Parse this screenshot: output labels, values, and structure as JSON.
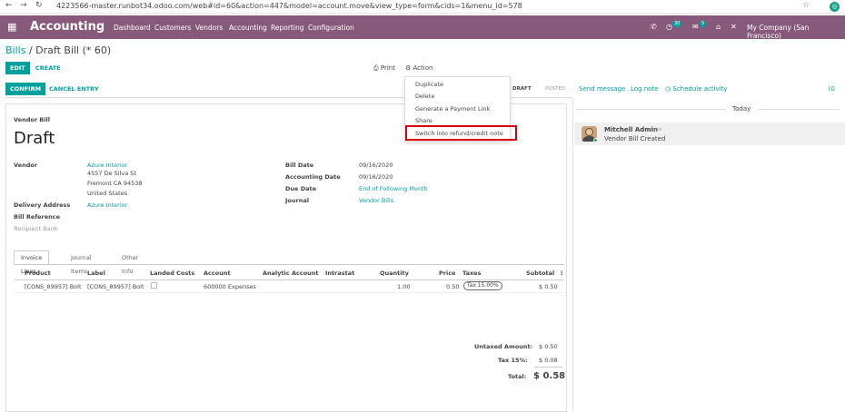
{
  "browser": {
    "url": "4223566-master.runbot34.odoo.com/web#id=60&action=447&model=account.move&view_type=form&cids=1&menu_id=578"
  },
  "topbar": {
    "app_name": "Accounting",
    "menu": [
      "Dashboard",
      "Customers",
      "Vendors",
      "Accounting",
      "Reporting",
      "Configuration"
    ],
    "activity_count": "30",
    "message_count": "5",
    "company": "My Company (San Francisco)"
  },
  "breadcrumb": {
    "parent": "Bills",
    "separator": "/",
    "current": "Draft Bill (* 60)"
  },
  "buttons": {
    "edit": "EDIT",
    "create": "CREATE",
    "print": "Print",
    "action": "Action",
    "confirm": "CONFIRM",
    "cancel_entry": "CANCEL ENTRY"
  },
  "status": {
    "draft": "DRAFT",
    "posted": "POSTED"
  },
  "action_menu": {
    "items": [
      "Duplicate",
      "Delete",
      "Generate a Payment Link",
      "Share",
      "Switch into refund/credit note"
    ]
  },
  "form": {
    "type_label": "Vendor Bill",
    "state_title": "Draft",
    "vendor_label": "Vendor",
    "vendor_name": "Azure Interior",
    "vendor_address": [
      "4557 De Silva St",
      "Fremont CA 94538",
      "United States"
    ],
    "delivery_label": "Delivery Address",
    "delivery_value": "Azure Interior",
    "bill_reference_label": "Bill Reference",
    "recipient_bank_label": "Recipient Bank",
    "bill_date_label": "Bill Date",
    "bill_date": "09/16/2020",
    "accounting_date_label": "Accounting Date",
    "accounting_date": "09/16/2020",
    "due_date_label": "Due Date",
    "due_date": "End of Following Month",
    "journal_label": "Journal",
    "journal": "Vendor Bills"
  },
  "tabs": [
    "Invoice Lines",
    "Journal Items",
    "Other Info"
  ],
  "table": {
    "columns": [
      "Product",
      "Label",
      "Landed Costs",
      "Account",
      "Analytic Account",
      "Intrastat",
      "Quantity",
      "Price",
      "Taxes",
      "Subtotal"
    ],
    "rows": [
      {
        "product": "[CONS_89957] Bolt",
        "label": "[CONS_89957] Bolt",
        "account": "600000 Expenses",
        "quantity": "1.00",
        "price": "0.50",
        "taxes": "Tax 15.00%",
        "subtotal": "$ 0.50"
      }
    ]
  },
  "totals": {
    "untaxed_label": "Untaxed Amount:",
    "untaxed_value": "$ 0.50",
    "tax_label": "Tax 15%:",
    "tax_value": "$ 0.08",
    "total_label": "Total:",
    "total_value": "$ 0.58"
  },
  "chatter": {
    "send_message": "Send message",
    "log_note": "Log note",
    "schedule_activity": "Schedule activity",
    "attachments": "0",
    "today": "Today",
    "message": {
      "author": "Mitchell Admin",
      "time": "now",
      "body": "Vendor Bill Created"
    }
  },
  "colors": {
    "brand": "#875a7b",
    "accent": "#00a09d",
    "highlight": "#d9000d"
  }
}
